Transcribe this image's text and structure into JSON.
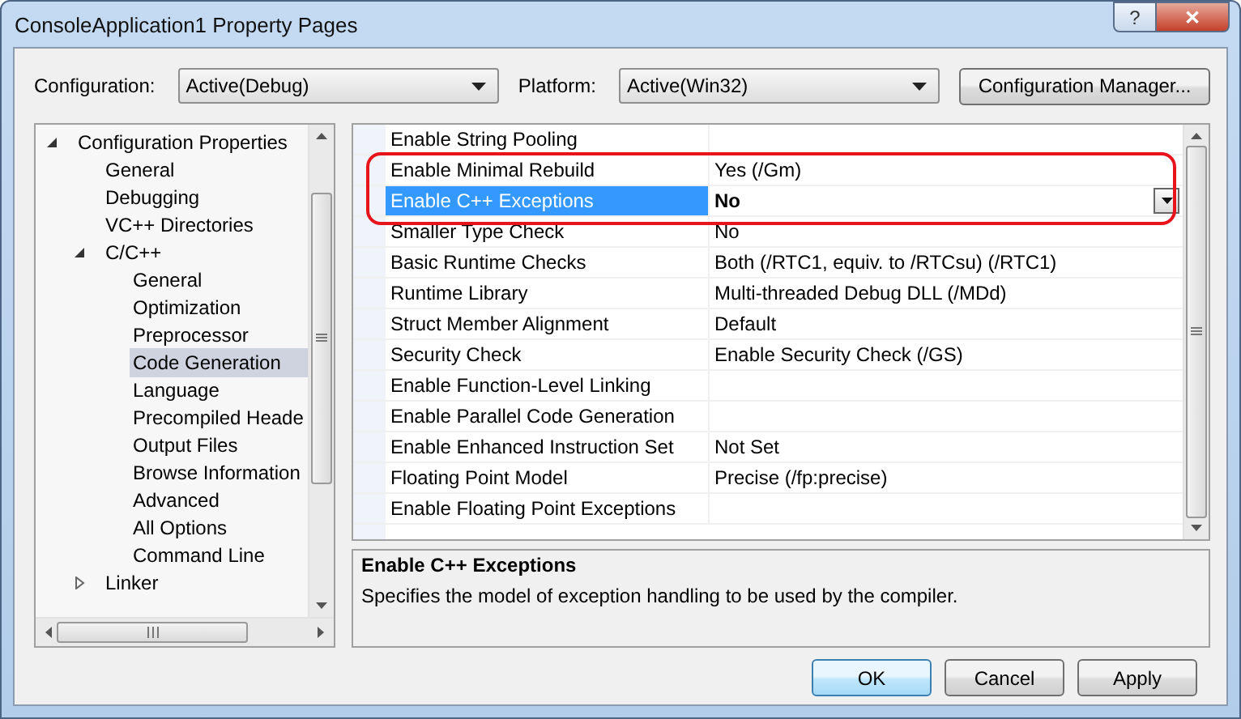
{
  "window": {
    "title": "ConsoleApplication1 Property Pages",
    "buttons": [
      "?",
      "✕"
    ]
  },
  "toolbar": {
    "configuration": {
      "label": "Configuration:",
      "value": "Active(Debug)"
    },
    "platform": {
      "label": "Platform:",
      "value": "Active(Win32)"
    },
    "manager_button": "Configuration Manager..."
  },
  "tree": [
    {
      "label": "Configuration Properties",
      "expanded": true,
      "selected": false,
      "children": [
        {
          "label": "General",
          "selected": false
        },
        {
          "label": "Debugging",
          "selected": false
        },
        {
          "label": "VC++ Directories",
          "selected": false
        },
        {
          "label": "C/C++",
          "expanded": true,
          "selected": false,
          "children": [
            {
              "label": "General",
              "selected": false
            },
            {
              "label": "Optimization",
              "selected": false
            },
            {
              "label": "Preprocessor",
              "selected": false
            },
            {
              "label": "Code Generation",
              "selected": true
            },
            {
              "label": "Language",
              "selected": false
            },
            {
              "label": "Precompiled Heade",
              "selected": false
            },
            {
              "label": "Output Files",
              "selected": false
            },
            {
              "label": "Browse Information",
              "selected": false
            },
            {
              "label": "Advanced",
              "selected": false
            },
            {
              "label": "All Options",
              "selected": false
            },
            {
              "label": "Command Line",
              "selected": false
            }
          ]
        },
        {
          "label": "Linker",
          "expanded": false,
          "selected": false
        }
      ]
    }
  ],
  "properties": [
    {
      "name": "Enable String Pooling",
      "selected": false,
      "circled": false
    },
    {
      "name": "Enable Minimal Rebuild",
      "value": "Yes (/Gm)",
      "selected": false,
      "circled": true
    },
    {
      "name": "Enable C++ Exceptions",
      "value": "No",
      "selected": true,
      "circled": true
    },
    {
      "name": "Smaller Type Check",
      "value": "No",
      "selected": false,
      "circled": false
    },
    {
      "name": "Basic Runtime Checks",
      "value": "Both (/RTC1, equiv. to /RTCsu) (/RTC1)",
      "selected": false,
      "circled": false
    },
    {
      "name": "Runtime Library",
      "value": "Multi-threaded Debug DLL (/MDd)",
      "selected": false,
      "circled": false
    },
    {
      "name": "Struct Member Alignment",
      "value": "Default",
      "selected": false,
      "circled": false
    },
    {
      "name": "Security Check",
      "value": "Enable Security Check (/GS)",
      "selected": false,
      "circled": false
    },
    {
      "name": "Enable Function-Level Linking",
      "selected": false,
      "circled": false
    },
    {
      "name": "Enable Parallel Code Generation",
      "selected": false,
      "circled": false
    },
    {
      "name": "Enable Enhanced Instruction Set",
      "value": "Not Set",
      "selected": false,
      "circled": false
    },
    {
      "name": "Floating Point Model",
      "value": "Precise (/fp:precise)",
      "selected": false,
      "circled": false
    },
    {
      "name": "Enable Floating Point Exceptions",
      "selected": false,
      "circled": false
    }
  ],
  "description": {
    "title": "Enable C++ Exceptions",
    "text": "Specifies the model of exception handling to be used by the compiler."
  },
  "buttons": [
    {
      "label": "OK",
      "default": true
    },
    {
      "label": "Cancel",
      "default": false
    },
    {
      "label": "Apply",
      "default": false
    }
  ]
}
